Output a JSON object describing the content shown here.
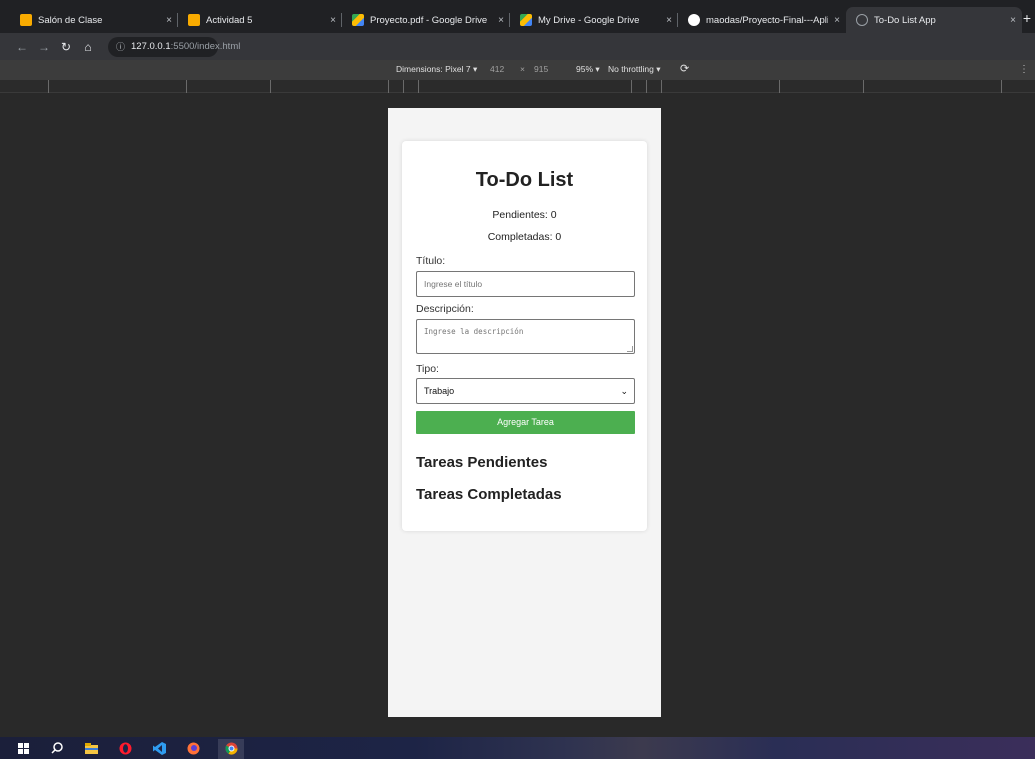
{
  "browser": {
    "tabs": [
      {
        "title": "Salón de Clase",
        "favicon_color": "#f9ab00",
        "active": false
      },
      {
        "title": "Actividad 5",
        "favicon_color": "#f9ab00",
        "active": false
      },
      {
        "title": "Proyecto.pdf - Google Drive",
        "favicon_color": "#34a853",
        "active": false
      },
      {
        "title": "My Drive - Google Drive",
        "favicon_color": "#34a853",
        "active": false
      },
      {
        "title": "maodas/Proyecto-Final---Aplica",
        "favicon_color": "#ffffff",
        "active": false
      },
      {
        "title": "To-Do List App",
        "favicon_color": "#9aa0a6",
        "active": true
      }
    ],
    "new_tab_label": "+",
    "close_glyph": "×",
    "address": {
      "host": "127.0.0.1",
      "path": ":5500/index.html"
    }
  },
  "device_toolbar": {
    "dimensions": "Dimensions: Pixel 7 ▾",
    "width": "412",
    "times": "×",
    "height": "915",
    "zoom": "95% ▾",
    "throttling": "No throttling ▾",
    "rotate_icon": "rotate-icon"
  },
  "app": {
    "title": "To-Do List",
    "pending": "Pendientes: 0",
    "completed": "Completadas: 0",
    "title_label": "Título:",
    "title_placeholder": "Ingrese el título",
    "desc_label": "Descripción:",
    "desc_placeholder": "Ingrese la descripción",
    "type_label": "Tipo:",
    "type_value": "Trabajo",
    "add_button": "Agregar Tarea",
    "pending_heading": "Tareas Pendientes",
    "completed_heading": "Tareas Completadas",
    "accent_color": "#4caf50"
  }
}
